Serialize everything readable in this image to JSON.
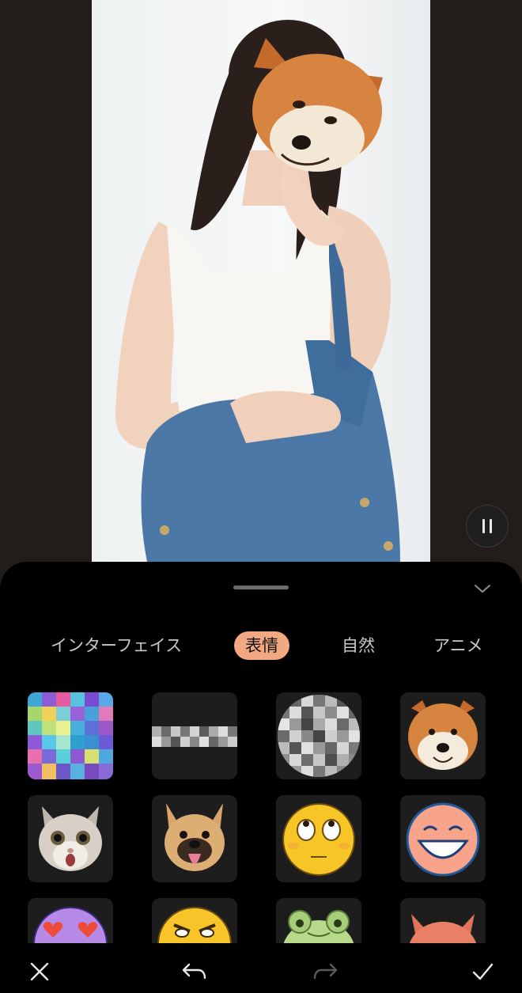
{
  "preview": {
    "play_state": "paused"
  },
  "sheet": {
    "tabs": [
      {
        "label": "インターフェイス",
        "active": false
      },
      {
        "label": "表情",
        "active": true
      },
      {
        "label": "自然",
        "active": false
      },
      {
        "label": "アニメ",
        "active": false
      }
    ],
    "stickers": [
      "mosaic-color-sticker",
      "mosaic-bar-sticker",
      "mosaic-circle-sticker",
      "shiba-dog-sticker",
      "cat-face-sticker",
      "french-bulldog-sticker",
      "eye-roll-emoji-sticker",
      "grinning-emoji-sticker",
      "heart-eyes-emoji-sticker",
      "angry-emoji-sticker",
      "frog-sticker",
      "fox-sticker"
    ],
    "accent_color": "#f2a883"
  },
  "toolbar": {
    "icons": [
      "close-icon",
      "undo-icon",
      "redo-icon",
      "confirm-icon"
    ],
    "redo_enabled": false
  }
}
